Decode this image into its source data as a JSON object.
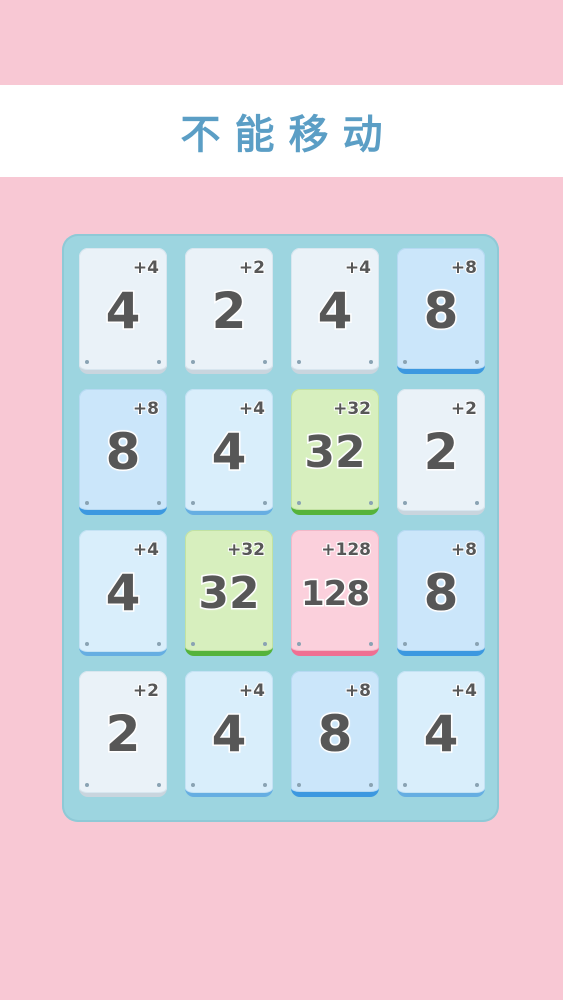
{
  "banner": {
    "message": "不能移动"
  },
  "board": {
    "rows": [
      [
        {
          "value": "4",
          "bonus": "+4",
          "variant": "white"
        },
        {
          "value": "2",
          "bonus": "+2",
          "variant": "white"
        },
        {
          "value": "4",
          "bonus": "+4",
          "variant": "white"
        },
        {
          "value": "8",
          "bonus": "+8",
          "variant": "blue"
        }
      ],
      [
        {
          "value": "8",
          "bonus": "+8",
          "variant": "blue"
        },
        {
          "value": "4",
          "bonus": "+4",
          "variant": "light"
        },
        {
          "value": "32",
          "bonus": "+32",
          "variant": "green"
        },
        {
          "value": "2",
          "bonus": "+2",
          "variant": "white"
        }
      ],
      [
        {
          "value": "4",
          "bonus": "+4",
          "variant": "light"
        },
        {
          "value": "32",
          "bonus": "+32",
          "variant": "green"
        },
        {
          "value": "128",
          "bonus": "+128",
          "variant": "pink"
        },
        {
          "value": "8",
          "bonus": "+8",
          "variant": "blue"
        }
      ],
      [
        {
          "value": "2",
          "bonus": "+2",
          "variant": "white"
        },
        {
          "value": "4",
          "bonus": "+4",
          "variant": "light"
        },
        {
          "value": "8",
          "bonus": "+8",
          "variant": "blue"
        },
        {
          "value": "4",
          "bonus": "+4",
          "variant": "light"
        }
      ]
    ]
  },
  "colors": {
    "background": "#f8c8d4",
    "banner_text": "#5b9ec5",
    "board": "#9dd5e0",
    "tile_green": "#55b33b",
    "tile_pink": "#ef6f92",
    "tile_blue": "#3c98e0"
  }
}
